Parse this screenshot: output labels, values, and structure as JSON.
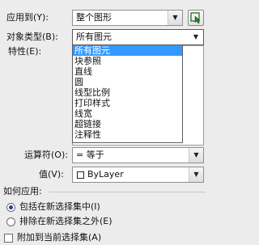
{
  "apply_to": {
    "label": "应用到(Y):",
    "value": "整个图形"
  },
  "object_type": {
    "label": "对象类型(B):",
    "value": "所有图元",
    "options": [
      "所有图元",
      "块参照",
      "直线",
      "圆",
      "线型比例",
      "打印样式",
      "线宽",
      "超链接",
      "注释性"
    ],
    "selected_index": 0
  },
  "properties": {
    "label": "特性(E):"
  },
  "operator": {
    "label": "运算符(O):",
    "value": "= 等于"
  },
  "value_field": {
    "label": "值(V):",
    "value": "ByLayer"
  },
  "how_to_apply": {
    "label": "如何应用:",
    "include": "包括在新选择集中(I)",
    "exclude": "排除在新选择集之外(E)",
    "selected": "include"
  },
  "append": {
    "label": "附加到当前选择集(A)",
    "checked": false
  },
  "colors": {
    "selection": "#3399ff",
    "panel": "#ececec"
  }
}
